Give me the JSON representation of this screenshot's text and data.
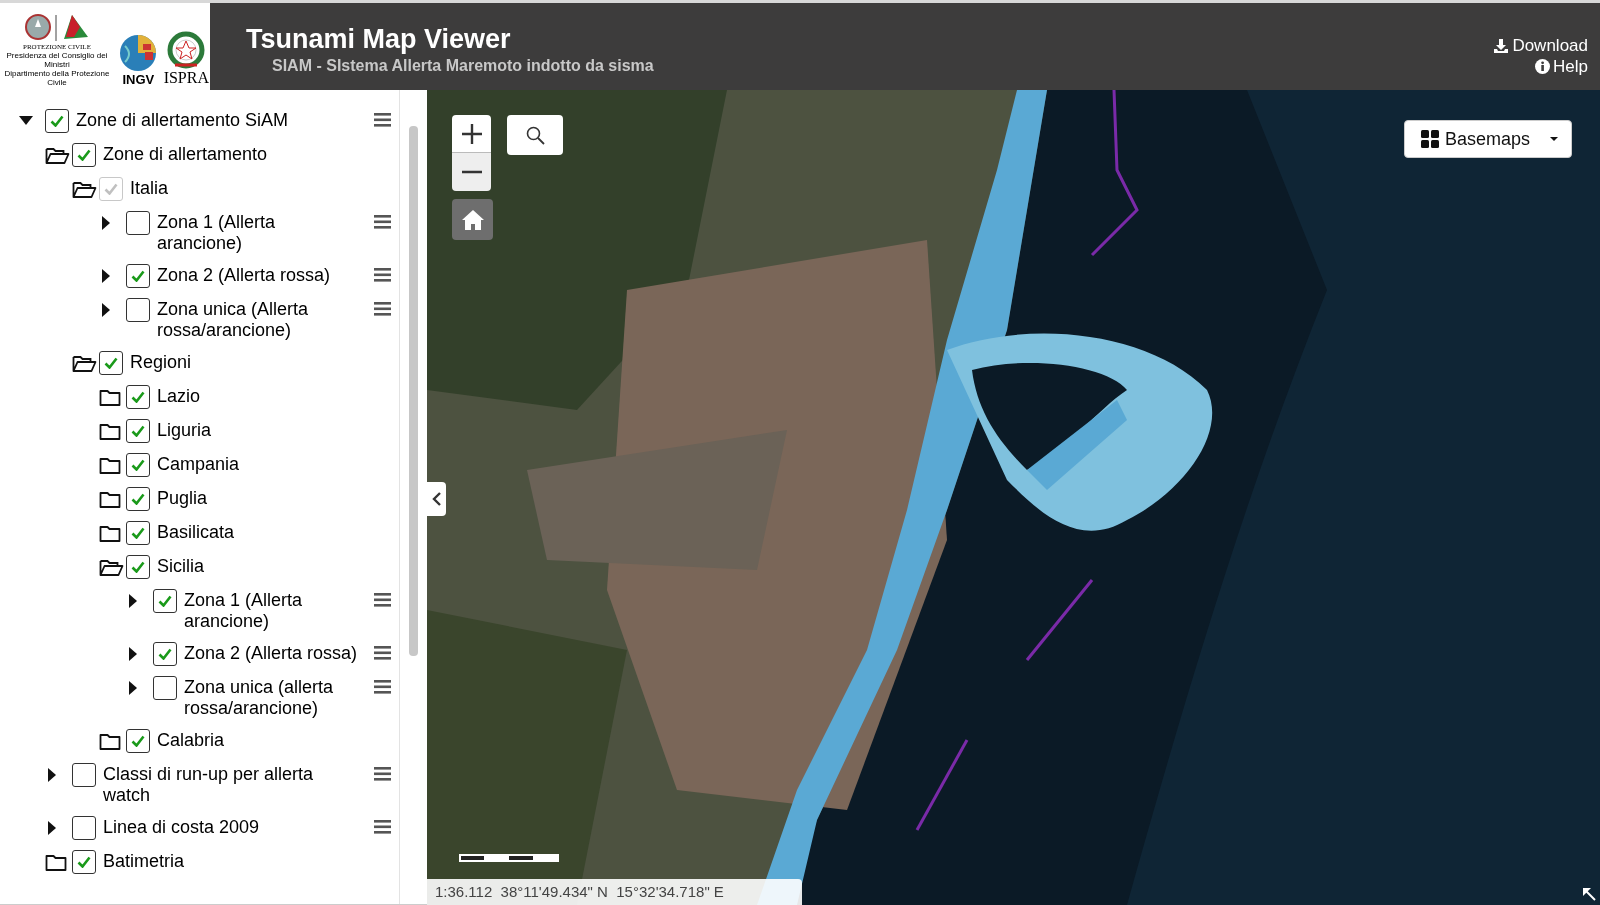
{
  "header": {
    "logos": [
      {
        "kind": "protezione",
        "lines": [
          "PROTEZIONE CIVILE",
          "Presidenza del Consiglio dei Ministri",
          "Dipartimento della Protezione Civile"
        ]
      },
      {
        "kind": "ingv",
        "lines": [
          "INGV"
        ]
      },
      {
        "kind": "ispra",
        "lines": [
          "ISPRA"
        ]
      }
    ],
    "title": "Tsunami Map Viewer",
    "subtitle": "SIAM - SIstema Allerta Maremoto indotto da sisma",
    "links": [
      {
        "kind": "download",
        "label": "Download"
      },
      {
        "kind": "help",
        "label": "Help"
      }
    ]
  },
  "layer_tree": [
    {
      "label": "Zone di allertamento SiAM",
      "kind": "caret",
      "expanded": true,
      "checked": true,
      "disabled": false,
      "menu": true,
      "children": [
        {
          "label": "Zone di allertamento",
          "kind": "folder",
          "expanded": true,
          "checked": true,
          "disabled": false,
          "menu": false,
          "children": [
            {
              "label": "Italia",
              "kind": "folder",
              "expanded": true,
              "checked": true,
              "disabled": true,
              "menu": false,
              "children": [
                {
                  "label": "Zona 1 (Allerta arancione)",
                  "kind": "caret",
                  "expanded": false,
                  "checked": false,
                  "disabled": false,
                  "menu": true
                },
                {
                  "label": "Zona 2 (Allerta rossa)",
                  "kind": "caret",
                  "expanded": false,
                  "checked": true,
                  "disabled": false,
                  "menu": true
                },
                {
                  "label": "Zona unica (Allerta rossa/arancione)",
                  "kind": "caret",
                  "expanded": false,
                  "checked": false,
                  "disabled": false,
                  "menu": true
                }
              ]
            },
            {
              "label": "Regioni",
              "kind": "folder",
              "expanded": true,
              "checked": true,
              "disabled": false,
              "menu": false,
              "children": [
                {
                  "label": "Lazio",
                  "kind": "folder",
                  "expanded": false,
                  "checked": true,
                  "disabled": false,
                  "menu": false
                },
                {
                  "label": "Liguria",
                  "kind": "folder",
                  "expanded": false,
                  "checked": true,
                  "disabled": false,
                  "menu": false
                },
                {
                  "label": "Campania",
                  "kind": "folder",
                  "expanded": false,
                  "checked": true,
                  "disabled": false,
                  "menu": false
                },
                {
                  "label": "Puglia",
                  "kind": "folder",
                  "expanded": false,
                  "checked": true,
                  "disabled": false,
                  "menu": false
                },
                {
                  "label": "Basilicata",
                  "kind": "folder",
                  "expanded": false,
                  "checked": true,
                  "disabled": false,
                  "menu": false
                },
                {
                  "label": "Sicilia",
                  "kind": "folder",
                  "expanded": true,
                  "checked": true,
                  "disabled": false,
                  "menu": false,
                  "children": [
                    {
                      "label": "Zona 1 (Allerta arancione)",
                      "kind": "caret",
                      "expanded": false,
                      "checked": true,
                      "disabled": false,
                      "menu": true
                    },
                    {
                      "label": "Zona 2 (Allerta rossa)",
                      "kind": "caret",
                      "expanded": false,
                      "checked": true,
                      "disabled": false,
                      "menu": true
                    },
                    {
                      "label": "Zona unica (allerta rossa/arancione)",
                      "kind": "caret",
                      "expanded": false,
                      "checked": false,
                      "disabled": false,
                      "menu": true
                    }
                  ]
                },
                {
                  "label": "Calabria",
                  "kind": "folder",
                  "expanded": false,
                  "checked": true,
                  "disabled": false,
                  "menu": false
                }
              ]
            }
          ]
        },
        {
          "label": "Classi di run-up per allerta watch",
          "kind": "caret",
          "expanded": false,
          "checked": false,
          "disabled": false,
          "menu": true
        },
        {
          "label": "Linea di costa 2009",
          "kind": "caret",
          "expanded": false,
          "checked": false,
          "disabled": false,
          "menu": true
        },
        {
          "label": "Batimetria",
          "kind": "folder",
          "expanded": false,
          "checked": true,
          "disabled": false,
          "menu": false
        }
      ]
    }
  ],
  "map": {
    "kind": "picture",
    "basemaps_button": "Basemaps",
    "status_bar": "1:36.112  38°11'49.434\" N  15°32'34.718\" E"
  }
}
